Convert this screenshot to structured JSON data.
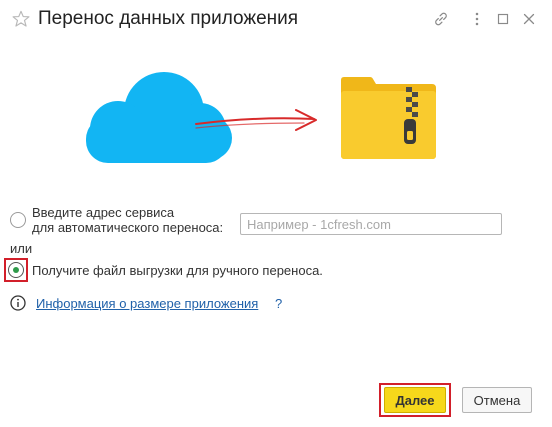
{
  "window": {
    "title": "Перенос данных приложения",
    "controls": [
      "link-icon",
      "more-icon",
      "maximize-icon",
      "close-icon"
    ]
  },
  "illustration": {
    "cloud_color": "#12b5f3",
    "folder_color": "#f9cb2e",
    "arrow_color": "#d82a2a"
  },
  "options": {
    "service": {
      "label_line1": "Введите адрес сервиса",
      "label_line2": "для автоматического переноса:",
      "input_value": "",
      "input_placeholder": "Например - 1cfresh.com",
      "selected": false
    },
    "or_label": "или",
    "file": {
      "label": "Получите файл выгрузки для ручного переноса.",
      "selected": true
    }
  },
  "info": {
    "link_label": "Информация о размере приложения",
    "help_label": "?"
  },
  "buttons": {
    "next_label": "Далее",
    "cancel_label": "Отмена"
  },
  "colors": {
    "accent_yellow": "#f6d81b",
    "highlight_red": "#d21f2a",
    "link_blue": "#2061a9",
    "radio_green": "#2e9a4a"
  }
}
